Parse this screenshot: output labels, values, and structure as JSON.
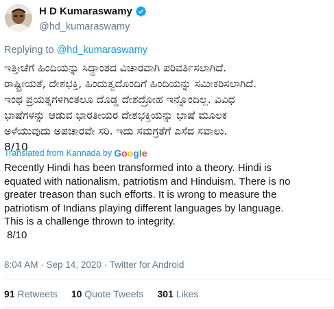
{
  "author": {
    "display_name": "H D Kumaraswamy",
    "handle": "@hd_kumaraswamy",
    "verified_icon": "verified-badge-icon",
    "avatar_icon": "profile-photo"
  },
  "reply": {
    "prefix": "Replying to",
    "handle": "@hd_kumaraswamy"
  },
  "tweet_text_lines": [
    "ಇತ್ತೀಚೆಗೆ ಹಿಂದಿಯನ್ನು ಸಿದ್ಧಾಂತದ ವಿಚಾರವಾಗಿ ಪರಿವರ್ತಿಸಲಾಗಿದೆ.",
    "ರಾಷ್ಟ್ರೀಯತೆ, ದೇಶಭಕ್ತಿ, ಹಿಂದುತ್ವದೊಂದಿಗೆ ಹಿಂದಿಯನ್ನು ಸಮೀಕರಿಸಲಾಗಿದೆ.",
    "ಇಂಥ ಪ್ರಯತ್ನಗಳಿಗಿಂತಲೂ ದೊಡ್ಡ ದೇಶದ್ರೋಹ ಇನ್ನೊಂದಿಲ್ಲ. ವಿವಿಧ",
    "ಭಾಷೆಗಳನ್ನು ಆಡುವ ಭಾರತೀಯರ ದೇಶಭಕ್ತಿಯನ್ನು ಭಾಷೆ ಮೂಲಕ",
    "ಅಳೆಯುವುದು ಅಪಚಾರವೇ ಸರಿ. ಇದು ಸಮಗ್ರತೆಗೆ ಎಸೆದ ಸವಾಲು.",
    "8/10"
  ],
  "translation": {
    "label": "Translated from Kannada by",
    "provider": "Google",
    "lines": [
      "Recently Hindi has been transformed into a theory. Hindi is",
      "equated with nationalism, patriotism and Hinduism. There is no",
      "greater treason than such efforts. It is wrong to measure the",
      "patriotism of Indians playing different languages by language.",
      "This is a challenge thrown to integrity.",
      " 8/10"
    ]
  },
  "meta": {
    "timestamp": "8:04 AM · Sep 14, 2020 · Twitter for Android"
  },
  "stats": {
    "retweets_count": "91",
    "retweets_label": "Retweets",
    "quote_count": "10",
    "quote_label": "Quote Tweets",
    "likes_count": "301",
    "likes_label": "Likes"
  },
  "colors": {
    "link": "#1b95e0",
    "secondary_text": "#657786",
    "primary_text": "#14171a",
    "verified": "#1da1f2"
  }
}
